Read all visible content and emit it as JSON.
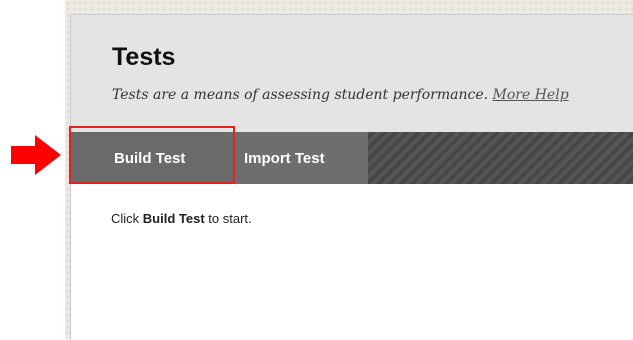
{
  "page": {
    "title": "Tests",
    "subtitle": "Tests are a means of assessing student performance.",
    "help_link": "More Help"
  },
  "actionbar": {
    "build_test": "Build Test",
    "import_test": "Import Test"
  },
  "content": {
    "instruction_prefix": "Click ",
    "instruction_bold": "Build Test",
    "instruction_suffix": " to start."
  },
  "colors": {
    "highlight": "#e32222",
    "arrow": "#ff0000",
    "actionbar": "#4e4e4e"
  },
  "icons": {
    "callout_arrow": "right-arrow-icon"
  }
}
